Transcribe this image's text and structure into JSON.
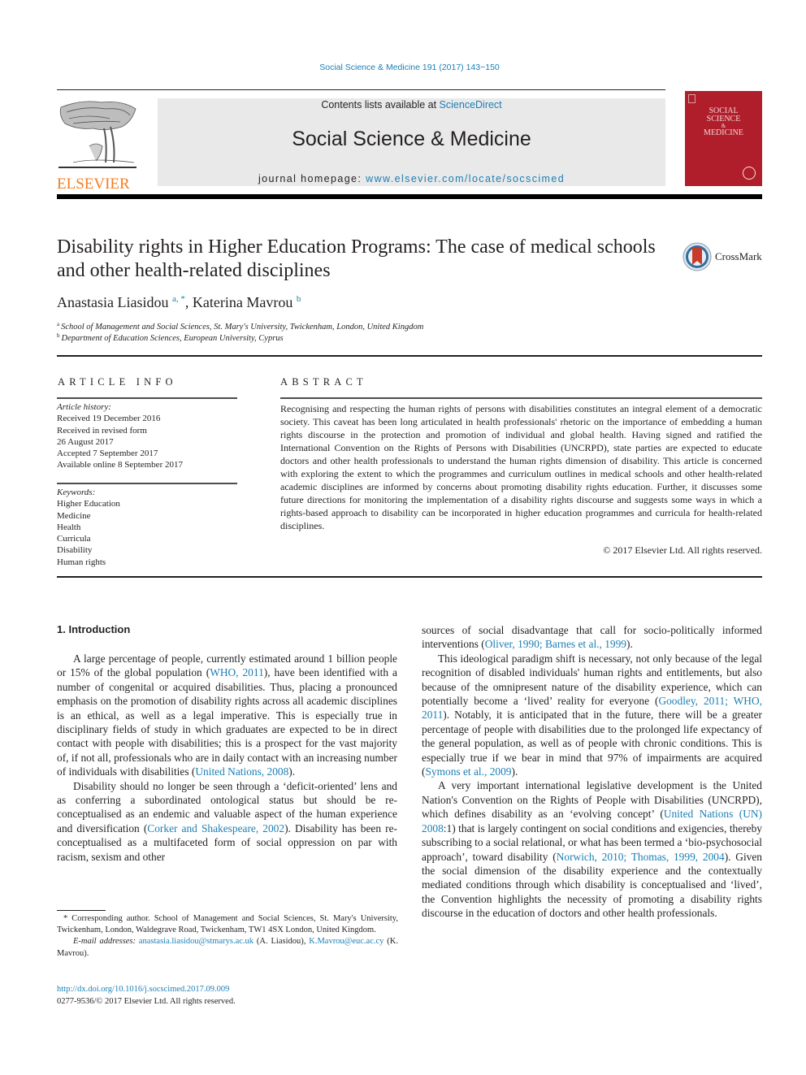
{
  "header": {
    "journal_ref": "Social Science & Medicine 191 (2017) 143−150",
    "contents_prefix": "Contents lists available at ",
    "contents_link": "ScienceDirect",
    "journal_name": "Social Science & Medicine",
    "homepage_prefix": "journal homepage: ",
    "homepage_link": "www.elsevier.com/locate/socscimed",
    "publisher_logo_text": "ELSEVIER",
    "cover": {
      "line1": "SOCIAL",
      "line2": "SCIENCE",
      "line3": "&",
      "line4": "MEDICINE",
      "color": "#b01e2b"
    },
    "colors": {
      "link": "#1a7fb5",
      "elsevier_orange": "#f47d20"
    }
  },
  "article": {
    "title": "Disability rights in Higher Education Programs: The case of medical schools and other health-related disciplines",
    "crossmark_label": "CrossMark",
    "authors": [
      {
        "name": "Anastasia Liasidou",
        "sup": "a, *"
      },
      {
        "name": "Katerina Mavrou",
        "sup": "b"
      }
    ],
    "author_separator": ", ",
    "affiliations": [
      {
        "label": "a",
        "text": "School of Management and Social Sciences, St. Mary's University, Twickenham, London, United Kingdom"
      },
      {
        "label": "b",
        "text": "Department of Education Sciences, European University, Cyprus"
      }
    ]
  },
  "article_info": {
    "heading": "ARTICLE INFO",
    "history_label": "Article history:",
    "history": [
      "Received 19 December 2016",
      "Received in revised form",
      "26 August 2017",
      "Accepted 7 September 2017",
      "Available online 8 September 2017"
    ],
    "keywords_label": "Keywords:",
    "keywords": [
      "Higher Education",
      "Medicine",
      "Health",
      "Curricula",
      "Disability",
      "Human rights"
    ]
  },
  "abstract": {
    "heading": "ABSTRACT",
    "text": "Recognising and respecting the human rights of persons with disabilities constitutes an integral element of a democratic society. This caveat has been long articulated in health professionals' rhetoric on the importance of embedding a human rights discourse in the protection and promotion of individual and global health. Having signed and ratified the International Convention on the Rights of Persons with Disabilities (UNCRPD), state parties are expected to educate doctors and other health professionals to understand the human rights dimension of disability. This article is concerned with exploring the extent to which the programmes and curriculum outlines in medical schools and other health-related academic disciplines are informed by concerns about promoting disability rights education. Further, it discusses some future directions for monitoring the implementation of a disability rights discourse and suggests some ways in which a rights-based approach to disability can be incorporated in higher education programmes and curricula for health-related disciplines.",
    "copyright": "© 2017 Elsevier Ltd. All rights reserved."
  },
  "body": {
    "section_heading": "1.  Introduction",
    "left_paragraphs": [
      [
        {
          "t": "A large percentage of people, currently estimated around 1 billion people or 15% of the global population ("
        },
        {
          "t": "WHO, 2011",
          "link": true
        },
        {
          "t": "), have been identified with a number of congenital or acquired disabilities. Thus, placing a pronounced emphasis on the promotion of disability rights across all academic disciplines is an ethical, as well as a legal imperative. This is especially true in disciplinary fields of study in which graduates are expected to be in direct contact with people with disabilities; this is a prospect for the vast majority of, if not all, professionals who are in daily contact with an increasing number of individuals with disabilities ("
        },
        {
          "t": "United Nations, 2008",
          "link": true
        },
        {
          "t": ")."
        }
      ],
      [
        {
          "t": "Disability should no longer be seen through a ‘deficit-oriented’ lens and as conferring a subordinated ontological status but should be re-conceptualised as an endemic and valuable aspect of the human experience and diversification ("
        },
        {
          "t": "Corker and Shakespeare, 2002",
          "link": true
        },
        {
          "t": "). Disability has been re-conceptualised as a multifaceted form of social oppression on par with racism, sexism and other"
        }
      ]
    ],
    "right_paragraphs": [
      [
        {
          "t": "sources of social disadvantage that call for socio-politically informed interventions ("
        },
        {
          "t": "Oliver, 1990; Barnes et al., 1999",
          "link": true
        },
        {
          "t": ")."
        }
      ],
      [
        {
          "t": "This ideological paradigm shift is necessary, not only because of the legal recognition of disabled individuals' human rights and entitlements, but also because of the omnipresent nature of the disability experience, which can potentially become a ‘lived’ reality for everyone ("
        },
        {
          "t": "Goodley, 2011; WHO, 2011",
          "link": true
        },
        {
          "t": "). Notably, it is anticipated that in the future, there will be a greater percentage of people with disabilities due to the prolonged life expectancy of the general population, as well as of people with chronic conditions. This is especially true if we bear in mind that 97% of impairments are acquired ("
        },
        {
          "t": "Symons et al., 2009",
          "link": true
        },
        {
          "t": ")."
        }
      ],
      [
        {
          "t": "A very important international legislative development is the United Nation's Convention on the Rights of People with Disabilities (UNCRPD), which defines disability as an ‘evolving concept’ ("
        },
        {
          "t": "United Nations (UN) 2008",
          "link": true
        },
        {
          "t": ":1) that is largely contingent on social conditions and exigencies, thereby subscribing to a social relational, or what has been termed a ‘bio-psychosocial approach’, toward disability ("
        },
        {
          "t": "Norwich, 2010; Thomas, 1999, 2004",
          "link": true
        },
        {
          "t": "). Given the social dimension of the disability experience and the contextually mediated conditions through which disability is conceptualised and ‘lived’, the Convention highlights the necessity of promoting a disability rights discourse in the education of doctors and other health professionals."
        }
      ]
    ]
  },
  "footnotes": {
    "corresponding": "* Corresponding author. School of Management and Social Sciences, St. Mary's University, Twickenham, London, Waldegrave Road, Twickenham, TW1 4SX London, United Kingdom.",
    "email_label": "E-mail addresses:",
    "email1": "anastasia.liasidou@stmarys.ac.uk",
    "email1_owner": " (A. Liasidou), ",
    "email2": "K.Mavrou@euc.ac.cy",
    "email2_owner": " (K. Mavrou).",
    "doi": "http://dx.doi.org/10.1016/j.socscimed.2017.09.009",
    "issn": "0277-9536/© 2017 Elsevier Ltd. All rights reserved."
  }
}
